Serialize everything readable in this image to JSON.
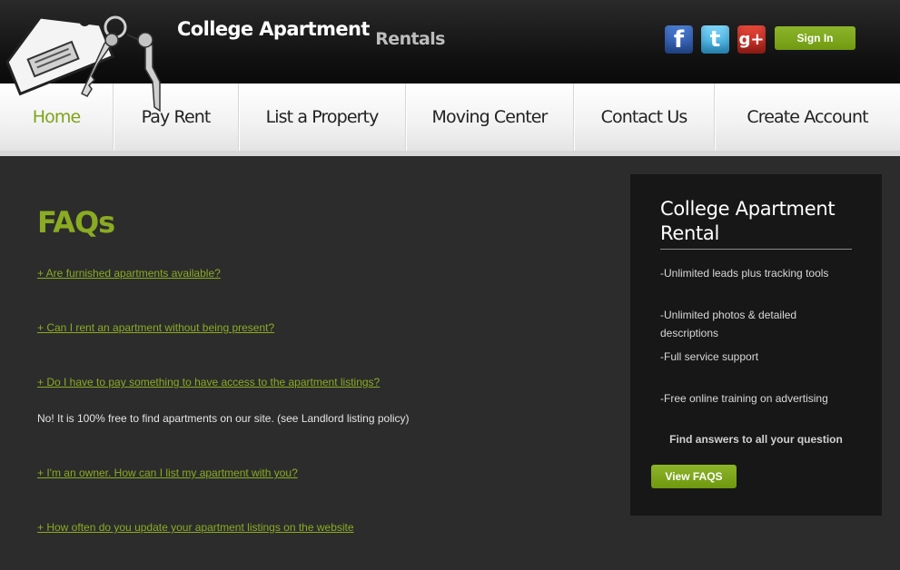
{
  "brand": {
    "main": "College Apartment",
    "sub": "Rentals"
  },
  "social": [
    {
      "name": "facebook",
      "glyph": "f"
    },
    {
      "name": "twitter",
      "glyph": "t"
    },
    {
      "name": "google-plus",
      "glyph": "g+"
    }
  ],
  "header": {
    "signin_label": "Sign In"
  },
  "nav": [
    {
      "label": "Home",
      "active": true
    },
    {
      "label": "Pay Rent"
    },
    {
      "label": "List a Property"
    },
    {
      "label": "Moving Center"
    },
    {
      "label": "Contact Us"
    },
    {
      "label": "Create Account"
    }
  ],
  "main": {
    "title": "FAQs",
    "faqs": [
      {
        "question": "+ Are furnished apartments available?"
      },
      {
        "question": "+ Can I rent an apartment without being present?"
      },
      {
        "question": "+ Do I have to pay something to have access to the apartment listings?",
        "answer": "No! It is 100% free to find apartments on our site. (see Landlord listing policy)"
      },
      {
        "question": "+ I'm an owner. How can I list my apartment with you?"
      },
      {
        "question": "+ How often do you update your apartment listings on the website"
      }
    ]
  },
  "sidebar": {
    "title": "College Apartment Rental",
    "items": [
      "-Unlimited leads plus tracking tools",
      "-Unlimited photos & detailed descriptions",
      "-Full service support",
      "-Free online training on advertising"
    ],
    "find_text": "Find answers to all your question",
    "button_label": "View FAQS"
  },
  "colors": {
    "accent": "#8aab22",
    "button": "#7fa318",
    "background": "#2c2c2c",
    "sidebar": "#171717"
  }
}
